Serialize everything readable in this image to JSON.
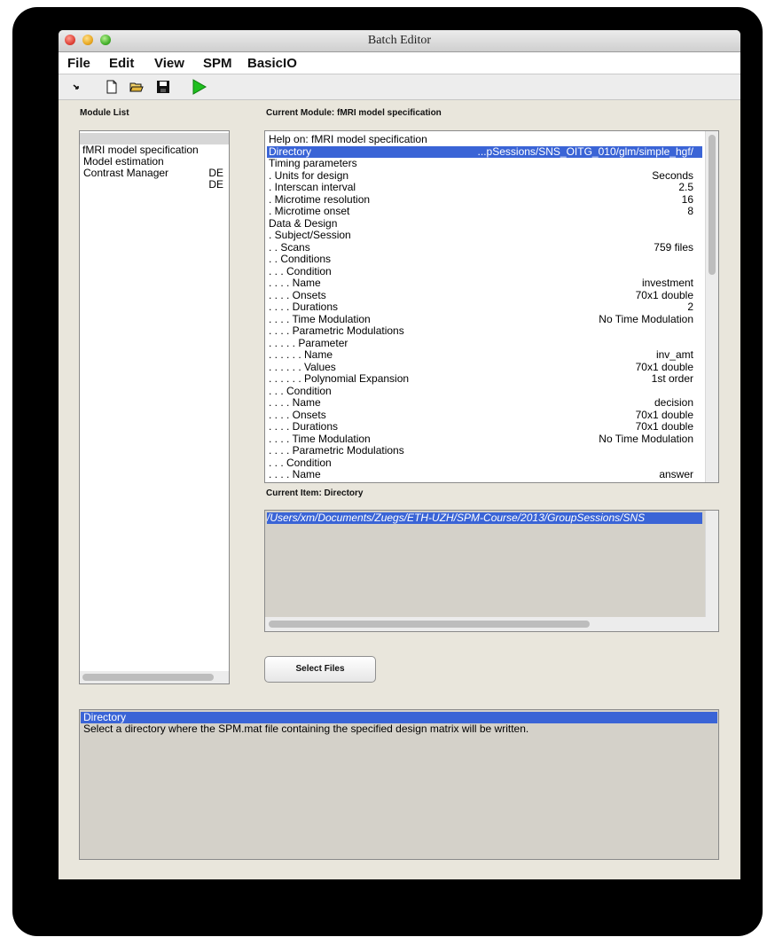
{
  "window": {
    "title": "Batch Editor"
  },
  "menu": [
    "File",
    "Edit",
    "View",
    "SPM",
    "BasicIO"
  ],
  "toolbar": {
    "icons": [
      "arrow-icon",
      "new-file-icon",
      "open-folder-icon",
      "save-icon",
      "run-icon"
    ],
    "run_color": "#1fbf1f"
  },
  "module_list": {
    "label": "Module List",
    "items": [
      {
        "name": "fMRI model specification",
        "status": ""
      },
      {
        "name": "Model estimation",
        "status": "DE"
      },
      {
        "name": "Contrast Manager",
        "status": "DE"
      }
    ]
  },
  "current_module": {
    "label": "Current Module: fMRI model specification",
    "rows": [
      {
        "k": "Help on: fMRI model specification",
        "v": ""
      },
      {
        "k": "Directory",
        "v": "...pSessions/SNS_OITG_010/glm/simple_hgf/"
      },
      {
        "k": "Timing parameters",
        "v": ""
      },
      {
        "k": ". Units for design",
        "v": "Seconds"
      },
      {
        "k": ". Interscan interval",
        "v": "2.5"
      },
      {
        "k": ". Microtime resolution",
        "v": "16"
      },
      {
        "k": ". Microtime onset",
        "v": "8"
      },
      {
        "k": "Data & Design",
        "v": ""
      },
      {
        "k": ". Subject/Session",
        "v": ""
      },
      {
        "k": ". . Scans",
        "v": "759 files"
      },
      {
        "k": ". . Conditions",
        "v": ""
      },
      {
        "k": ". . . Condition",
        "v": ""
      },
      {
        "k": ". . . . Name",
        "v": "investment"
      },
      {
        "k": ". . . . Onsets",
        "v": "70x1 double"
      },
      {
        "k": ". . . . Durations",
        "v": "2"
      },
      {
        "k": ". . . . Time Modulation",
        "v": "No Time Modulation"
      },
      {
        "k": ". . . . Parametric Modulations",
        "v": ""
      },
      {
        "k": ". . . . . Parameter",
        "v": ""
      },
      {
        "k": ". . . . . . Name",
        "v": "inv_amt"
      },
      {
        "k": ". . . . . . Values",
        "v": "70x1 double"
      },
      {
        "k": ". . . . . . Polynomial Expansion",
        "v": "1st order"
      },
      {
        "k": ". . . Condition",
        "v": ""
      },
      {
        "k": ". . . . Name",
        "v": "decision"
      },
      {
        "k": ". . . . Onsets",
        "v": "70x1 double"
      },
      {
        "k": ". . . . Durations",
        "v": "70x1 double"
      },
      {
        "k": ". . . . Time Modulation",
        "v": "No Time Modulation"
      },
      {
        "k": ". . . . Parametric Modulations",
        "v": ""
      },
      {
        "k": ". . . Condition",
        "v": ""
      },
      {
        "k": ". . . . Name",
        "v": "answer"
      }
    ]
  },
  "current_item": {
    "label": "Current Item: Directory",
    "value": "/Users/xm/Documents/Zuegs/ETH-UZH/SPM-Course/2013/GroupSessions/SNS"
  },
  "select_files_button": "Select Files",
  "help": {
    "title": "Directory",
    "text": "Select a directory where the SPM.mat file containing the specified design matrix will be written."
  },
  "colors": {
    "selection": "#3a64d6",
    "window_bg": "#e9e6dc"
  }
}
